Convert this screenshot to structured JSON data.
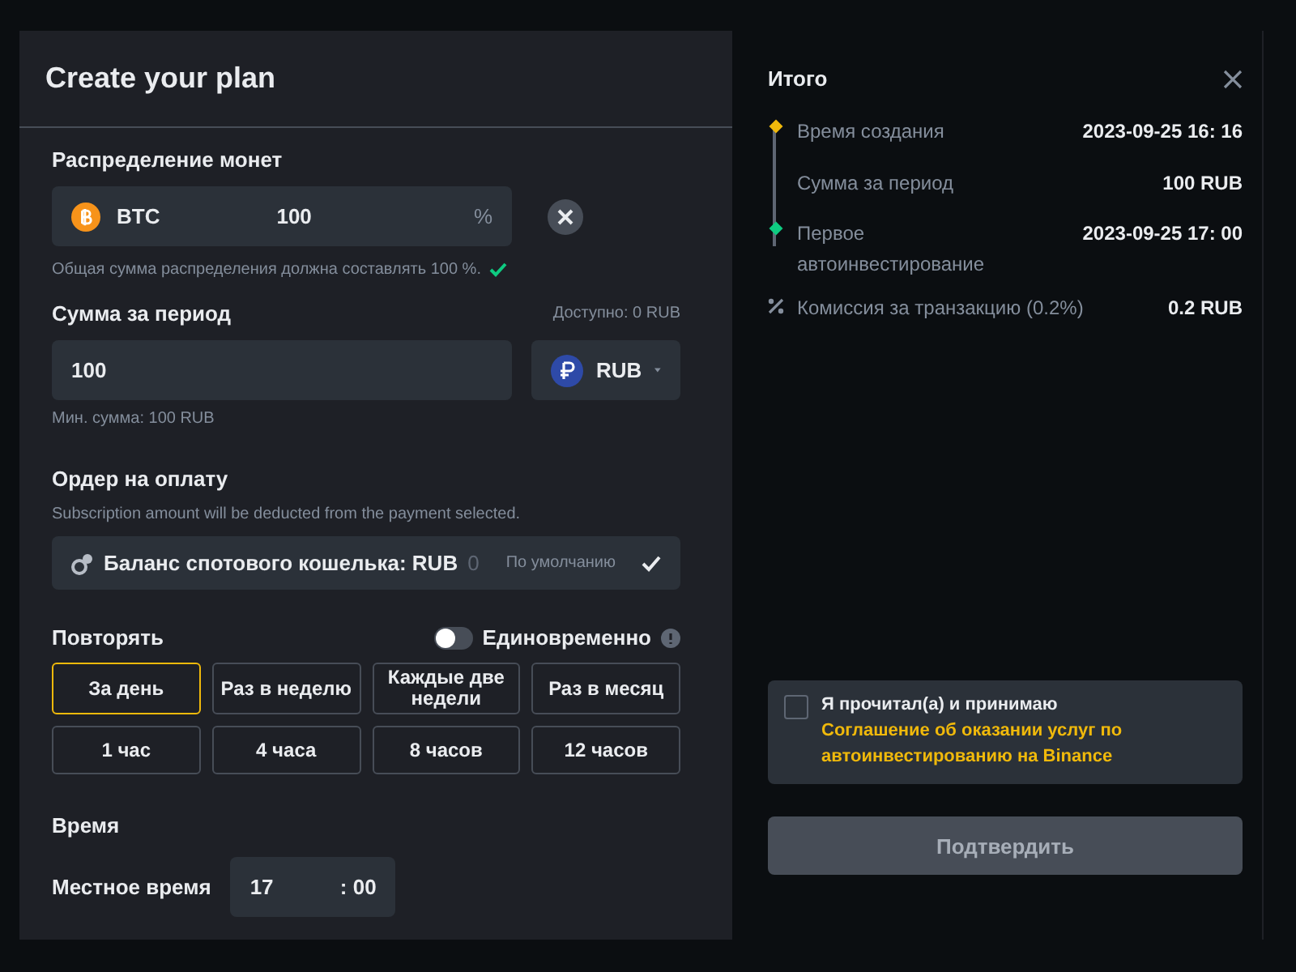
{
  "plan": {
    "title": "Create your plan",
    "allocation": {
      "label": "Распределение монет",
      "coin": "BTC",
      "value": "100",
      "unit": "%",
      "note": "Общая сумма распределения должна составлять 100 %.",
      "valid": true
    },
    "amount": {
      "label": "Сумма за период",
      "available": "Доступно: 0 RUB",
      "value": "100",
      "currency": "RUB",
      "min": "Мин. сумма: 100 RUB"
    },
    "payment": {
      "label": "Ордер на оплату",
      "description": "Subscription amount will be deducted from the payment selected.",
      "method": "Баланс спотового кошелька: RUB",
      "balance": "0",
      "default_label": "По умолчанию",
      "selected": true
    },
    "repeat": {
      "label": "Повторять",
      "one_time": {
        "label": "Единовременно",
        "on": false
      },
      "options": [
        {
          "label": "За день",
          "selected": true
        },
        {
          "label": "Раз в неделю",
          "selected": false
        },
        {
          "label": "Каждые две недели",
          "selected": false
        },
        {
          "label": "Раз в месяц",
          "selected": false
        },
        {
          "label": "1 час",
          "selected": false
        },
        {
          "label": "4 часа",
          "selected": false
        },
        {
          "label": "8 часов",
          "selected": false
        },
        {
          "label": "12 часов",
          "selected": false
        }
      ]
    },
    "time": {
      "label": "Время",
      "local_label": "Местное время",
      "hour": "17",
      "minute": ": 00"
    }
  },
  "summary": {
    "title": "Итого",
    "timeline": [
      {
        "label": "Время создания",
        "value": "2023-09-25 16: 16",
        "color": "#f0b90b"
      },
      {
        "label": "Сумма за период",
        "value": "100 RUB"
      },
      {
        "label": "Первое автоинвестирование",
        "value": "2023-09-25 17: 00",
        "color": "#0ecb81"
      }
    ],
    "fee": {
      "label": "Комиссия за транзакцию (0.2%)",
      "value": "0.2 RUB"
    },
    "agreement": {
      "text": "Я прочитал(а) и принимаю",
      "link": "Соглашение об оказании услуг по автоинвестированию на Binance",
      "checked": false
    },
    "confirm": {
      "label": "Подтвердить",
      "disabled": true
    }
  }
}
